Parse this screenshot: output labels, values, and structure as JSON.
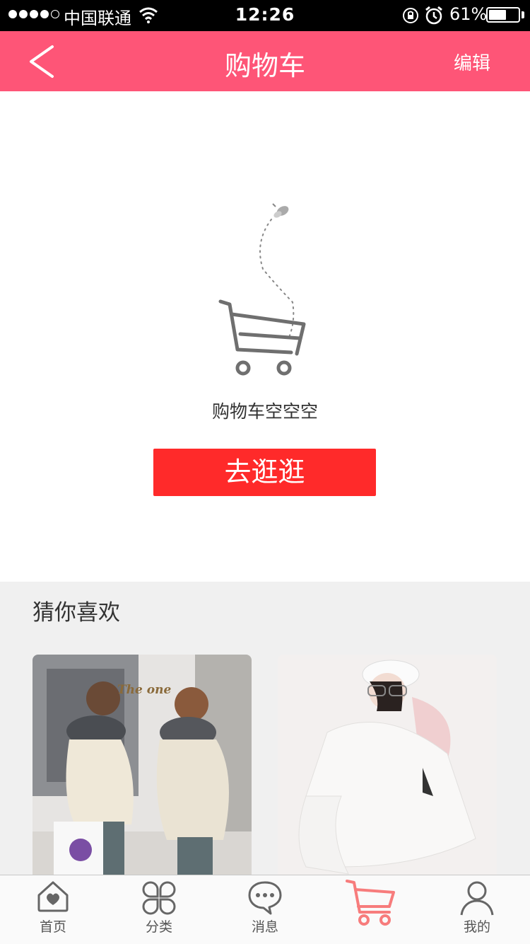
{
  "status_bar": {
    "carrier": "中国联通",
    "time": "12:26",
    "battery_percent": "61%",
    "battery_level": 0.61
  },
  "nav": {
    "title": "购物车",
    "edit_label": "编辑",
    "back_icon": "chevron-left-icon"
  },
  "empty_state": {
    "message": "购物车空空空",
    "button_label": "去逛逛",
    "icon": "shopping-cart-icon"
  },
  "recommend": {
    "title": "猜你喜欢",
    "products": [
      {
        "image_text": "The one"
      },
      {
        "image_text": ""
      }
    ]
  },
  "tabs": [
    {
      "label": "首页",
      "icon": "home-icon",
      "active": false
    },
    {
      "label": "分类",
      "icon": "category-icon",
      "active": false
    },
    {
      "label": "消息",
      "icon": "message-icon",
      "active": false
    },
    {
      "label": "",
      "icon": "cart-icon",
      "active": true
    },
    {
      "label": "我的",
      "icon": "profile-icon",
      "active": false
    }
  ],
  "colors": {
    "brand_pink": "#fe5577",
    "button_red": "#ff2a2a",
    "active_tab": "#f77c7c"
  }
}
